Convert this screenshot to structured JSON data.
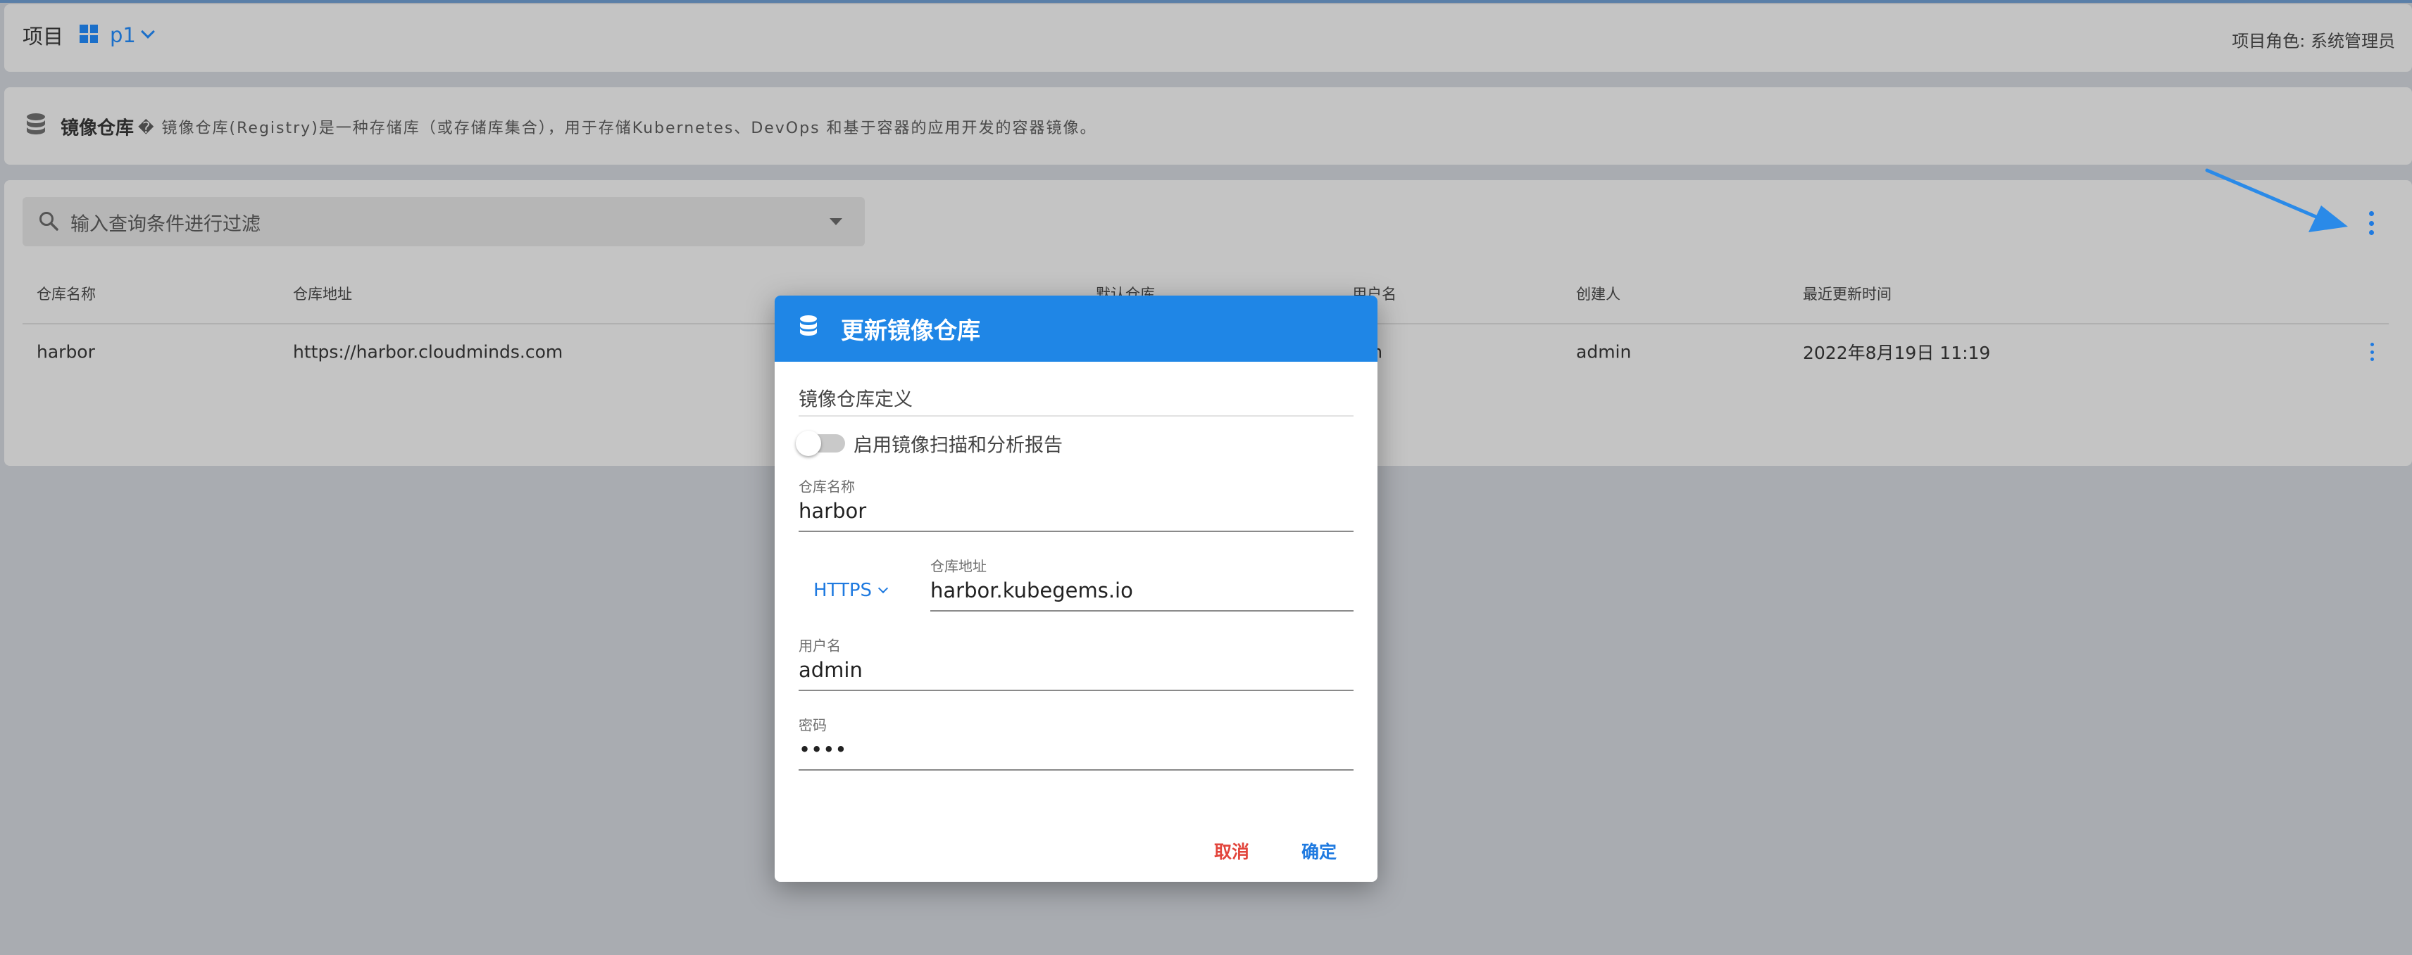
{
  "header": {
    "project_label": "项目",
    "project_name": "p1",
    "role_text": "项目角色: 系统管理员"
  },
  "registry_info": {
    "title": "镜像仓库",
    "description": "� 镜像仓库(Registry)是一种存储库（或存储库集合），用于存储Kubernetes、DevOps 和基于容器的应用开发的容器镜像。"
  },
  "filter": {
    "placeholder": "输入查询条件进行过滤"
  },
  "table": {
    "columns": [
      "仓库名称",
      "仓库地址",
      "默认仓库",
      "用户名",
      "创建人",
      "最近更新时间"
    ],
    "rows": [
      {
        "name": "harbor",
        "address": "https://harbor.cloudminds.com",
        "username": "min",
        "creator": "admin",
        "updated": "2022年8月19日 11:19"
      }
    ]
  },
  "dialog": {
    "title": "更新镜像仓库",
    "section_title": "镜像仓库定义",
    "scan_toggle_label": "启用镜像扫描和分析报告",
    "scan_enabled": false,
    "fields": {
      "name_label": "仓库名称",
      "name_value": "harbor",
      "protocol": "HTTPS",
      "address_label": "仓库地址",
      "address_value": "harbor.kubegems.io",
      "username_label": "用户名",
      "username_value": "admin",
      "password_label": "密码",
      "password_value": "••••"
    },
    "cancel_label": "取消",
    "confirm_label": "确定"
  },
  "colors": {
    "accent": "#1f86e6",
    "cancel": "#e2453c",
    "annotation_arrow": "#2a8ae8"
  },
  "icons": [
    "grid-icon",
    "chevron-down-icon",
    "database-icon",
    "search-icon",
    "caret-down-icon",
    "more-vertical-icon",
    "arrow-annotation-icon"
  ]
}
